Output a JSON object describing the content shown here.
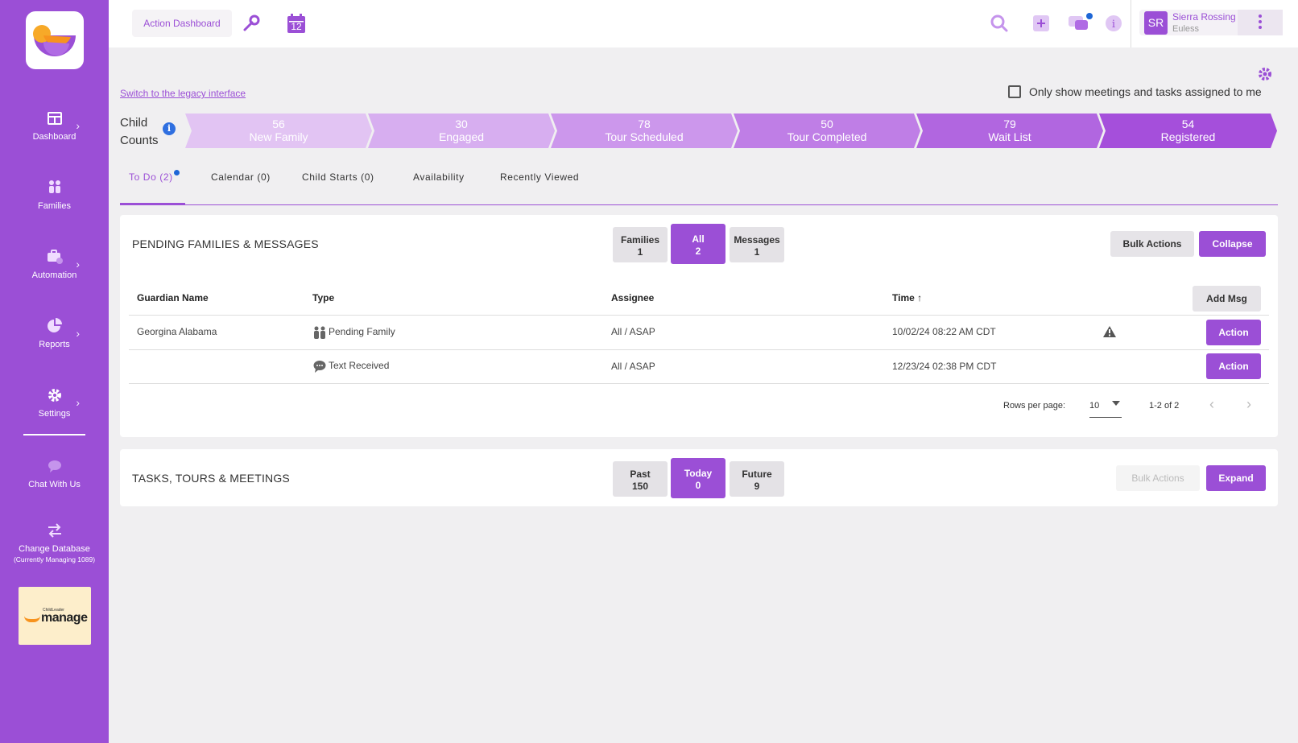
{
  "header": {
    "action_dashboard_label": "Action Dashboard",
    "calendar_day": "12",
    "user": {
      "initials": "SR",
      "name": "Sierra Rossing",
      "location": "Euless"
    }
  },
  "sidebar": {
    "items": [
      {
        "label": "Dashboard"
      },
      {
        "label": "Families"
      },
      {
        "label": "Automation"
      },
      {
        "label": "Reports"
      },
      {
        "label": "Settings"
      },
      {
        "label": "Chat With Us"
      },
      {
        "label": "Change Database",
        "sub": "(Currently Managing 1089)"
      }
    ],
    "manage_small": "ChildLeader",
    "manage_word": "manage"
  },
  "legacy_link": "Switch to the legacy interface",
  "only_show_label": "Only show meetings and tasks assigned to me",
  "child_counts": {
    "label_line1": "Child",
    "label_line2": "Counts",
    "stages": [
      {
        "count": "56",
        "label": "New Family",
        "color": "#e2c4f3"
      },
      {
        "count": "30",
        "label": "Engaged",
        "color": "#d7aef0"
      },
      {
        "count": "78",
        "label": "Tour Scheduled",
        "color": "#cc97ec"
      },
      {
        "count": "50",
        "label": "Tour Completed",
        "color": "#bf7ee6"
      },
      {
        "count": "79",
        "label": "Wait List",
        "color": "#b166e0"
      },
      {
        "count": "54",
        "label": "Registered",
        "color": "#a54fdb"
      }
    ]
  },
  "tabs": [
    {
      "label": "To Do (2)"
    },
    {
      "label": "Calendar (0)"
    },
    {
      "label": "Child Starts (0)"
    },
    {
      "label": "Availability"
    },
    {
      "label": "Recently Viewed"
    }
  ],
  "pending": {
    "title": "PENDING FAMILIES & MESSAGES",
    "filters": [
      {
        "label": "Families",
        "count": "1"
      },
      {
        "label": "All",
        "count": "2"
      },
      {
        "label": "Messages",
        "count": "1"
      }
    ],
    "bulk_actions": "Bulk Actions",
    "collapse": "Collapse",
    "columns": {
      "guardian": "Guardian Name",
      "type": "Type",
      "assignee": "Assignee",
      "time": "Time ↑"
    },
    "add_msg": "Add Msg",
    "rows": [
      {
        "guardian": "Georgina Alabama",
        "type": "Pending Family",
        "assignee": "All / ASAP",
        "time": "10/02/24 08:22 AM CDT",
        "action": "Action"
      },
      {
        "guardian": "",
        "type": "Text Received",
        "assignee": "All / ASAP",
        "time": "12/23/24 02:38 PM CDT",
        "action": "Action"
      }
    ],
    "pager": {
      "rows_label": "Rows per page:",
      "rows_value": "10",
      "range": "1-2 of 2"
    }
  },
  "tasks": {
    "title": "TASKS, TOURS & MEETINGS",
    "filters": [
      {
        "label": "Past",
        "count": "150"
      },
      {
        "label": "Today",
        "count": "0"
      },
      {
        "label": "Future",
        "count": "9"
      }
    ],
    "bulk_actions": "Bulk Actions",
    "expand": "Expand"
  }
}
